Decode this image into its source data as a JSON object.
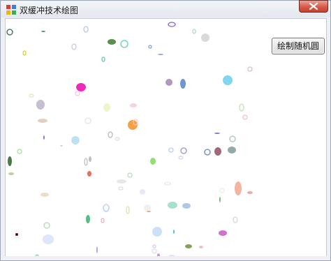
{
  "window": {
    "title": "双缓冲技术绘图",
    "close_icon": "close-icon",
    "app_icon": "app-icon"
  },
  "canvas": {
    "draw_button_label": "绘制随机圆",
    "background_color": "#ffffff"
  }
}
